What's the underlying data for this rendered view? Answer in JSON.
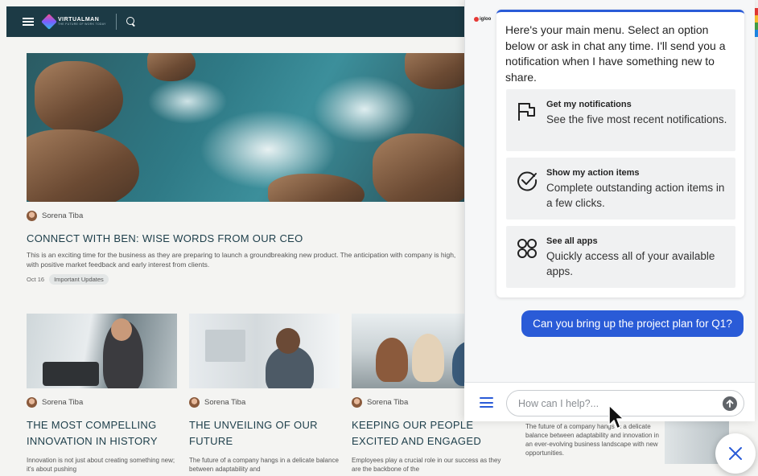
{
  "intranet": {
    "brand": {
      "name": "VIRTUALMAN",
      "tagline": "THE FUTURE OF WORK TODAY"
    },
    "icons": {
      "menu": "hamburger-icon",
      "search": "search-icon"
    },
    "featured": {
      "author": "Sorena Tiba",
      "title": "CONNECT WITH BEN: WISE WORDS FROM OUR CEO",
      "excerpt": "This is an exciting time for the business as they are preparing to launch a groundbreaking new product. The anticipation with company is high, with positive market feedback and early interest from clients.",
      "date": "Oct 16",
      "tag": "Important Updates"
    },
    "cards": [
      {
        "author": "Sorena Tiba",
        "title": "THE MOST COMPELLING INNOVATION IN HISTORY",
        "text": "Innovation is not just about creating something new; it's about pushing"
      },
      {
        "author": "Sorena Tiba",
        "title": "THE UNVEILING OF OUR FUTURE",
        "text": "The future of a company hangs in a delicate balance between adaptability and"
      },
      {
        "author": "Sorena Tiba",
        "title": "KEEPING OUR PEOPLE EXCITED AND ENGAGED",
        "text": "Employees play a crucial role in our success as they are the backbone of the"
      }
    ],
    "card4_text": "The future of a company hangs in a delicate balance between adaptability and innovation in an ever-evolving business landscape with new opportunities."
  },
  "chat": {
    "brand": "igloo",
    "intro": "Here's your main menu. Select an option below or ask in chat any time. I'll send you a notification when I have something new to share.",
    "options": [
      {
        "title": "Get my notifications",
        "desc": "See the five most recent notifications.",
        "icon": "flag-icon"
      },
      {
        "title": "Show my action items",
        "desc": "Complete outstanding action items in a few clicks.",
        "icon": "check-circle-icon"
      },
      {
        "title": "See all apps",
        "desc": "Quickly access all of your available apps.",
        "icon": "apps-grid-icon"
      }
    ],
    "user_message": "Can you bring up the project plan for Q1?",
    "input_placeholder": "How can I help?...",
    "colors": {
      "accent": "#2a5bd7",
      "page_header": "#1c3a45"
    }
  }
}
